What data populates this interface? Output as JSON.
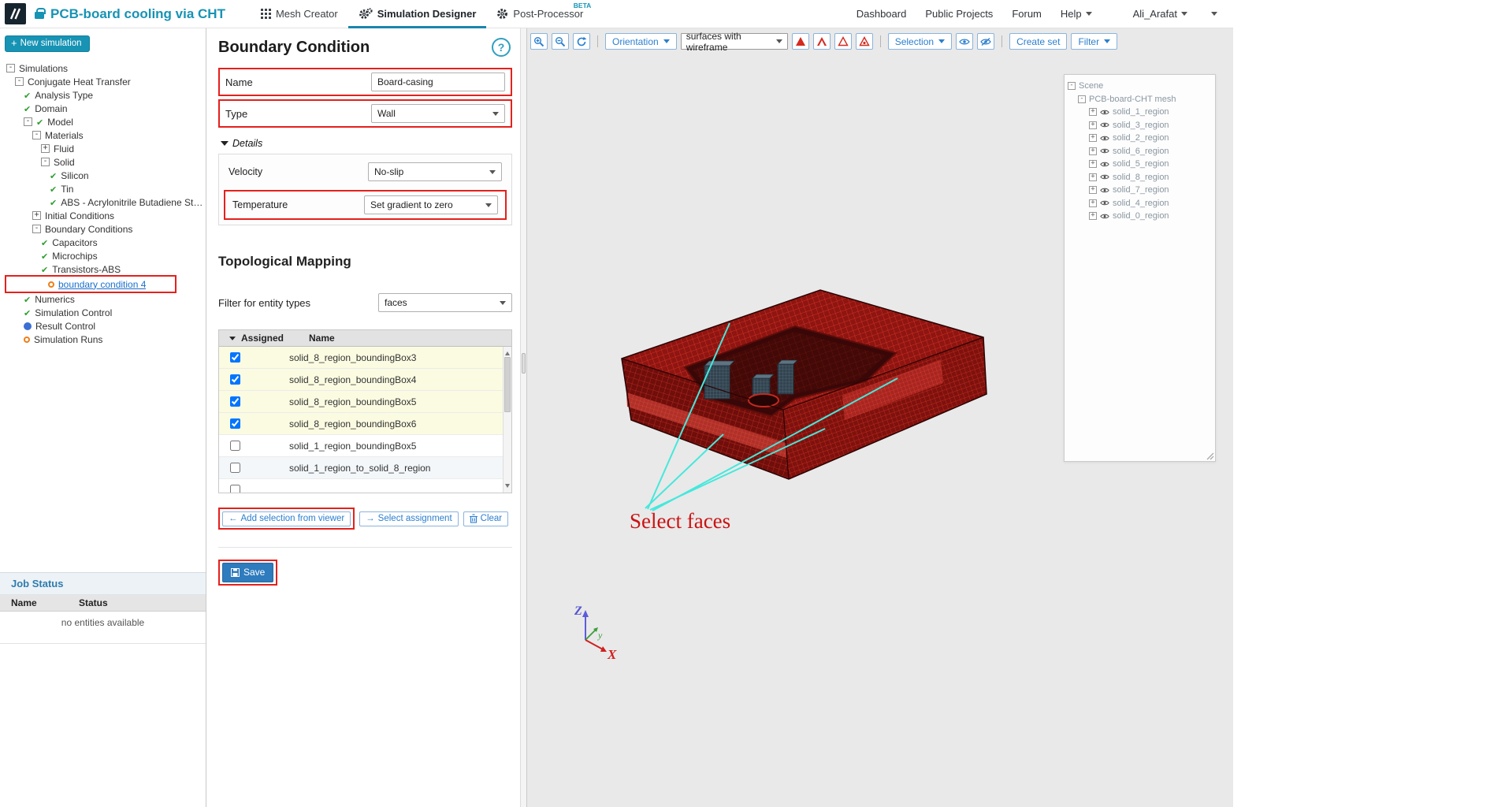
{
  "header": {
    "project_title": "PCB-board cooling via CHT",
    "tabs": [
      {
        "label": "Mesh Creator"
      },
      {
        "label": "Simulation Designer"
      },
      {
        "label": "Post-Processor",
        "badge": "BETA"
      }
    ],
    "links": {
      "dashboard": "Dashboard",
      "public_projects": "Public Projects",
      "forum": "Forum",
      "help": "Help",
      "user": "Ali_Arafat"
    }
  },
  "sidebar": {
    "new_simulation_label": "New simulation",
    "tree": [
      {
        "level": 0,
        "toggle": "minus",
        "icon": null,
        "label": "Simulations"
      },
      {
        "level": 1,
        "toggle": "minus",
        "icon": null,
        "label": "Conjugate Heat Transfer"
      },
      {
        "level": 2,
        "toggle": null,
        "icon": "check",
        "label": "Analysis Type"
      },
      {
        "level": 2,
        "toggle": null,
        "icon": "check",
        "label": "Domain"
      },
      {
        "level": 2,
        "toggle": "minus",
        "icon": "check",
        "label": "Model"
      },
      {
        "level": 3,
        "toggle": "minus",
        "icon": null,
        "label": "Materials"
      },
      {
        "level": 4,
        "toggle": "plus",
        "icon": null,
        "label": "Fluid"
      },
      {
        "level": 4,
        "toggle": "minus",
        "icon": null,
        "label": "Solid"
      },
      {
        "level": 5,
        "toggle": null,
        "icon": "check",
        "label": "Silicon"
      },
      {
        "level": 5,
        "toggle": null,
        "icon": "check",
        "label": "Tin"
      },
      {
        "level": 5,
        "toggle": null,
        "icon": "check",
        "label": "ABS - Acrylonitrile Butadiene Styre..."
      },
      {
        "level": 3,
        "toggle": "plus",
        "icon": null,
        "label": "Initial Conditions"
      },
      {
        "level": 3,
        "toggle": "minus",
        "icon": null,
        "label": "Boundary Conditions"
      },
      {
        "level": 4,
        "toggle": null,
        "icon": "check",
        "label": "Capacitors"
      },
      {
        "level": 4,
        "toggle": null,
        "icon": "check",
        "label": "Microchips"
      },
      {
        "level": 4,
        "toggle": null,
        "icon": "check",
        "label": "Transistors-ABS"
      },
      {
        "level": 4,
        "toggle": null,
        "icon": "orange",
        "label": "boundary condition 4",
        "selected": true
      },
      {
        "level": 2,
        "toggle": null,
        "icon": "check",
        "label": "Numerics"
      },
      {
        "level": 2,
        "toggle": null,
        "icon": "check",
        "label": "Simulation Control"
      },
      {
        "level": 2,
        "toggle": null,
        "icon": "blue",
        "label": "Result Control"
      },
      {
        "level": 2,
        "toggle": null,
        "icon": "orange",
        "label": "Simulation Runs"
      }
    ],
    "job_status": {
      "title": "Job Status",
      "columns": [
        "Name",
        "Status"
      ],
      "empty_message": "no entities available"
    }
  },
  "panel": {
    "title": "Boundary Condition",
    "help_label": "?",
    "name_label": "Name",
    "name_value": "Board-casing",
    "type_label": "Type",
    "type_value": "Wall",
    "details_label": "Details",
    "velocity_label": "Velocity",
    "velocity_value": "No-slip",
    "temperature_label": "Temperature",
    "temperature_value": "Set gradient to zero",
    "topological_title": "Topological Mapping",
    "filter_label": "Filter for entity types",
    "filter_value": "faces",
    "table": {
      "assigned_header": "Assigned",
      "name_header": "Name",
      "rows": [
        {
          "checked": true,
          "name": "solid_8_region_boundingBox3"
        },
        {
          "checked": true,
          "name": "solid_8_region_boundingBox4"
        },
        {
          "checked": true,
          "name": "solid_8_region_boundingBox5"
        },
        {
          "checked": true,
          "name": "solid_8_region_boundingBox6"
        },
        {
          "checked": false,
          "name": "solid_1_region_boundingBox5"
        },
        {
          "checked": false,
          "name": "solid_1_region_to_solid_8_region"
        },
        {
          "checked": false,
          "name": ""
        }
      ]
    },
    "buttons": {
      "add_selection": "Add selection from viewer",
      "select_assignment": "Select assignment",
      "clear": "Clear",
      "save": "Save"
    }
  },
  "viewer": {
    "toolbar": {
      "orientation": "Orientation",
      "render_mode": "surfaces with wireframe",
      "selection": "Selection",
      "create_set": "Create set",
      "filter": "Filter"
    },
    "annotation": "Select faces",
    "axes": {
      "x": "X",
      "y": "y",
      "z": "Z"
    },
    "scene_tree": {
      "root": "Scene",
      "mesh": "PCB-board-CHT mesh",
      "items": [
        "solid_1_region",
        "solid_3_region",
        "solid_2_region",
        "solid_6_region",
        "solid_5_region",
        "solid_8_region",
        "solid_7_region",
        "solid_4_region",
        "solid_0_region"
      ]
    }
  },
  "colors": {
    "brand_teal": "#1793b4",
    "annotation_red": "#e4211c",
    "check_green": "#2f9e2f",
    "pending_orange": "#ee7e18",
    "optional_blue": "#3b6fd4",
    "save_blue": "#2e7bbd",
    "cyan_line": "#45e8dc",
    "mesh_red": "#8e1511"
  }
}
